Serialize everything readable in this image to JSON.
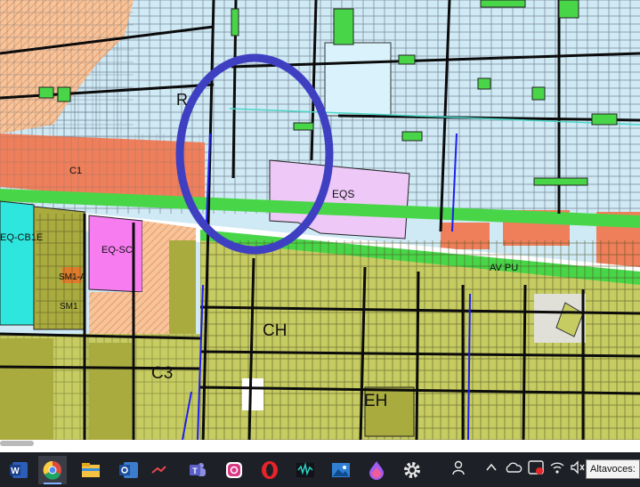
{
  "map": {
    "labels": {
      "r": "R",
      "c1": "C1",
      "eqs": "EQS",
      "eq_cb1e": "EQ-CB1E",
      "eq_sc": "EQ-SC",
      "sm1_a": "SM1-A",
      "sm1": "SM1",
      "av_pu": "AV PU",
      "ch": "CH",
      "c3": "C3",
      "eh": "EH"
    },
    "colors": {
      "residential": "#cfe9f5",
      "commercial": "#ef7f5a",
      "green": "#48d648",
      "equipment_special": "#eec9f7",
      "equipment_commercial": "#f77cf0",
      "mixed_use": "#c6cc62",
      "mixed_use_dark": "#a9ab3e",
      "cyan_zone": "#2ee6de",
      "highlight_ellipse": "#3f3fc2"
    }
  },
  "taskbar": {
    "apps": [
      "word-icon",
      "chrome-icon",
      "file-explorer-icon",
      "outlook-icon",
      "media-player-icon",
      "teams-icon",
      "instagram-icon",
      "opera-icon",
      "audio-editor-icon",
      "photos-icon",
      "paint-icon",
      "settings-icon"
    ],
    "tray_icons": [
      "people-icon",
      "chevron-up-icon",
      "onedrive-icon",
      "antivirus-icon",
      "wifi-icon",
      "speaker-mute-icon"
    ],
    "tooltip": "Altavoces:"
  }
}
